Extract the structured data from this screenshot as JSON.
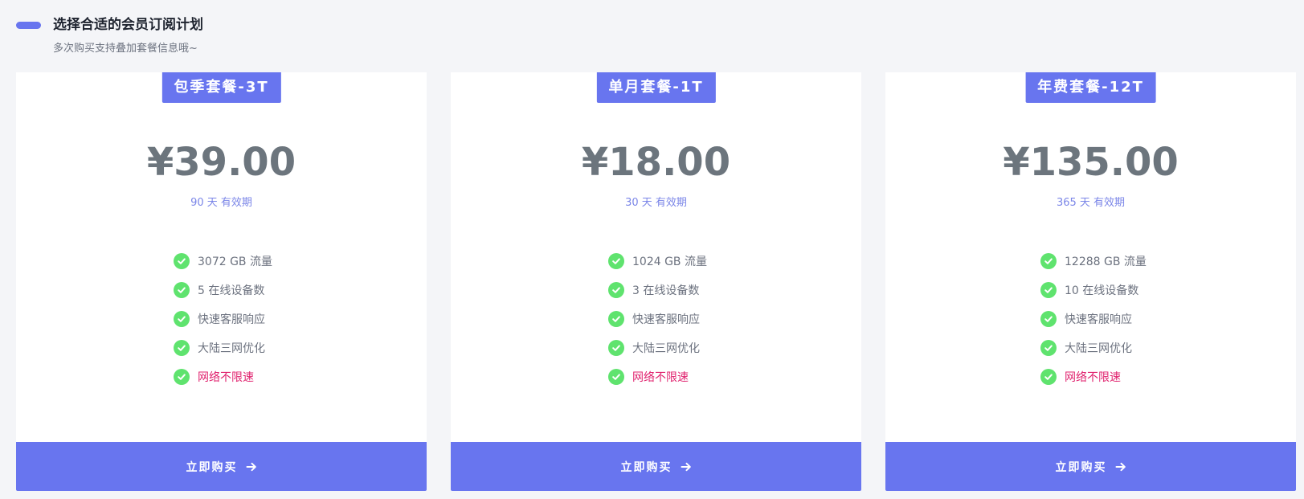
{
  "header": {
    "title": "选择合适的会员订阅计划",
    "subtitle": "多次购买支持叠加套餐信息哦~",
    "accent_color": "#6875ef"
  },
  "plans": [
    {
      "name": "包季套餐-3T",
      "price": "¥39.00",
      "validity": "90 天 有效期",
      "features": [
        "3072 GB 流量",
        "5 在线设备数",
        "快速客服响应",
        "大陆三网优化",
        "网络不限速"
      ],
      "buy_label": "立即购买"
    },
    {
      "name": "单月套餐-1T",
      "price": "¥18.00",
      "validity": "30 天 有效期",
      "features": [
        "1024 GB 流量",
        "3 在线设备数",
        "快速客服响应",
        "大陆三网优化",
        "网络不限速"
      ],
      "buy_label": "立即购买"
    },
    {
      "name": "年费套餐-12T",
      "price": "¥135.00",
      "validity": "365 天 有效期",
      "features": [
        "12288 GB 流量",
        "10 在线设备数",
        "快速客服响应",
        "大陆三网优化",
        "网络不限速"
      ],
      "buy_label": "立即购买"
    }
  ],
  "icons": {
    "feature": "check-circle-icon",
    "buy": "arrow-right-icon"
  },
  "colors": {
    "check": "#5fe36e",
    "highlight_feature": "#e0226e",
    "price": "#6c757d"
  }
}
